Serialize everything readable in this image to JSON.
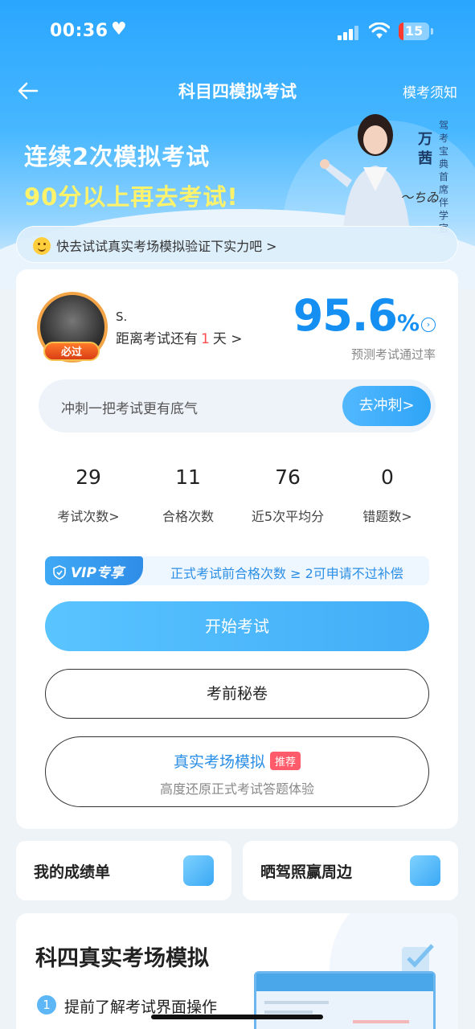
{
  "status_bar": {
    "time": "00:36",
    "battery": "15"
  },
  "nav": {
    "title": "科目四模拟考试",
    "right_link": "模考须知"
  },
  "hero": {
    "line1": "连续2次模拟考试",
    "line2": "90分以上再去考试!",
    "presenter_name": "万茜",
    "presenter_title": "驾考宝典首席伴学官"
  },
  "tip_bar": {
    "text": "快去试试真实考场模拟验证下实力吧 >"
  },
  "profile": {
    "avatar_badge": "必过",
    "name": "S.",
    "countdown_prefix": "距离考试还有",
    "countdown_days": "1",
    "countdown_suffix": "天 >"
  },
  "pass_rate": {
    "value": "95.6",
    "unit": "%",
    "label": "预测考试通过率"
  },
  "sprint": {
    "text": "冲刺一把考试更有底气",
    "button": "去冲刺>"
  },
  "stats": [
    {
      "value": "29",
      "label": "考试次数>"
    },
    {
      "value": "11",
      "label": "合格次数"
    },
    {
      "value": "76",
      "label": "近5次平均分"
    },
    {
      "value": "0",
      "label": "错题数>"
    }
  ],
  "vip": {
    "tag": "VIP专享",
    "text": "正式考试前合格次数 ≥ 2可申请不过补偿"
  },
  "buttons": {
    "start": "开始考试",
    "secret": "考前秘卷",
    "sim_title": "真实考场模拟",
    "sim_badge": "推荐",
    "sim_sub": "高度还原正式考试答题体验"
  },
  "mini_cards": [
    {
      "label": "我的成绩单",
      "icon": "search-report-icon"
    },
    {
      "label": "晒驾照赢周边",
      "icon": "id-card-icon"
    }
  ],
  "bottom": {
    "title": "科四真实考场模拟",
    "step_num": "1",
    "step_text": "提前了解考试界面操作"
  },
  "colors": {
    "primary": "#2ea4f6",
    "accent_yellow": "#fff36b",
    "danger": "#ff4d4f"
  }
}
